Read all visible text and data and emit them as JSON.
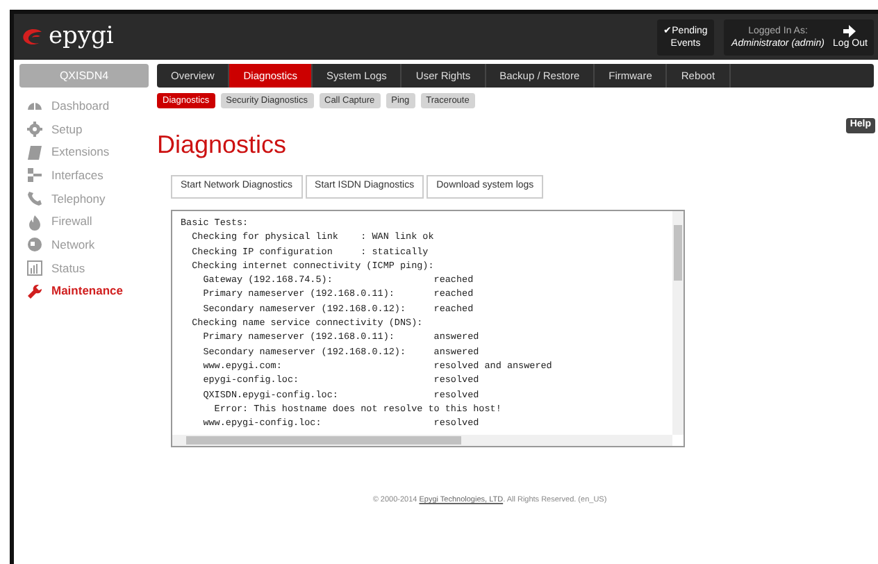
{
  "header": {
    "logo": "epygi",
    "pending": {
      "check": "✔",
      "label": "Pending",
      "label2": "Events"
    },
    "login": {
      "label": "Logged In As:",
      "user": "Administrator (admin)"
    },
    "logout": "Log Out"
  },
  "device": "QXISDN4",
  "tabs": [
    {
      "label": "Overview",
      "selected": false
    },
    {
      "label": "Diagnostics",
      "selected": true
    },
    {
      "label": "System Logs",
      "selected": false
    },
    {
      "label": "User Rights",
      "selected": false
    },
    {
      "label": "Backup / Restore",
      "selected": false
    },
    {
      "label": "Firmware",
      "selected": false
    },
    {
      "label": "Reboot",
      "selected": false
    }
  ],
  "sidebar": {
    "items": [
      {
        "label": "Dashboard",
        "selected": false
      },
      {
        "label": "Setup",
        "selected": false
      },
      {
        "label": "Extensions",
        "selected": false
      },
      {
        "label": "Interfaces",
        "selected": false
      },
      {
        "label": "Telephony",
        "selected": false
      },
      {
        "label": "Firewall",
        "selected": false
      },
      {
        "label": "Network",
        "selected": false
      },
      {
        "label": "Status",
        "selected": false
      },
      {
        "label": "Maintenance",
        "selected": true
      }
    ]
  },
  "subtabs": [
    {
      "label": "Diagnostics",
      "selected": true
    },
    {
      "label": "Security Diagnostics",
      "selected": false
    },
    {
      "label": "Call Capture",
      "selected": false
    },
    {
      "label": "Ping",
      "selected": false
    },
    {
      "label": "Traceroute",
      "selected": false
    }
  ],
  "help": "Help",
  "title": "Diagnostics",
  "buttons": [
    "Start Network Diagnostics",
    "Start ISDN Diagnostics",
    "Download system logs"
  ],
  "log": [
    "Basic Tests:",
    "  Checking for physical link    : WAN link ok",
    "  Checking IP configuration     : statically",
    "  Checking internet connectivity (ICMP ping):",
    "    Gateway (192.168.74.5):                  reached",
    "    Primary nameserver (192.168.0.11):       reached",
    "    Secondary nameserver (192.168.0.12):     reached",
    "  Checking name service connectivity (DNS):",
    "    Primary nameserver (192.168.0.11):       answered",
    "    Secondary nameserver (192.168.0.12):     answered",
    "    www.epygi.com:                           resolved and answered",
    "    epygi-config.loc:                        resolved",
    "    QXISDN.epygi-config.loc:                 resolved",
    "      Error: This hostname does not resolve to this host!",
    "    www.epygi-config.loc:                    resolved"
  ],
  "footer": {
    "before": "© 2000-2014 ",
    "link": "Epygi Technologies, LTD",
    "after": ". All Rights Reserved. (en_US)"
  }
}
